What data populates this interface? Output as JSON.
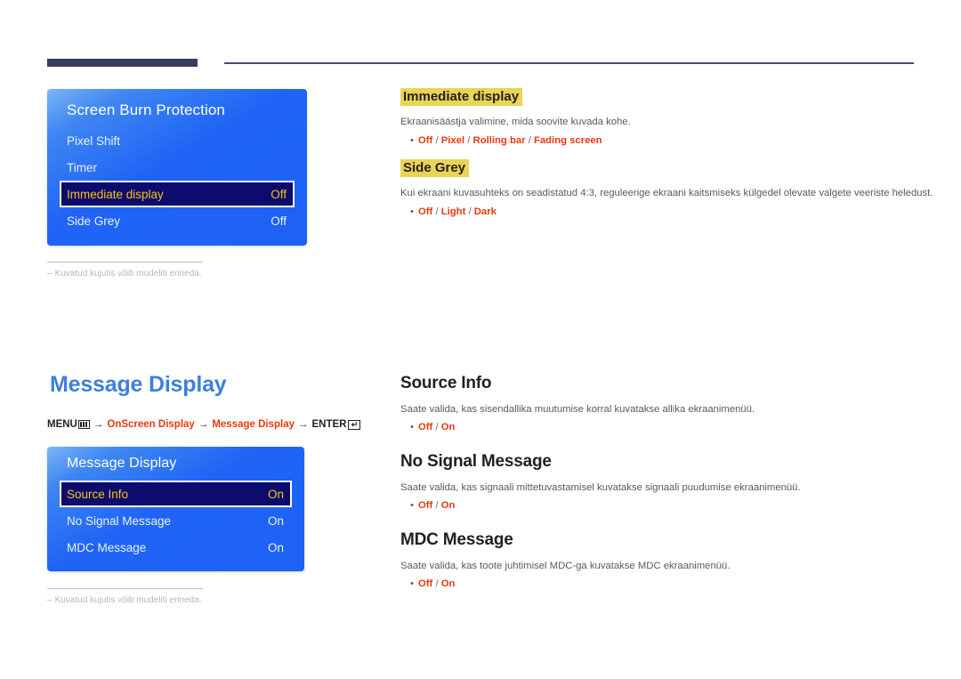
{
  "header": {
    "rule_label": "top-divider"
  },
  "osd_panels": [
    {
      "title": "Screen Burn Protection",
      "rows": [
        {
          "label": "Pixel Shift",
          "value": "",
          "selected": false
        },
        {
          "label": "Timer",
          "value": "",
          "selected": false
        },
        {
          "label": "Immediate display",
          "value": "Off",
          "selected": true
        },
        {
          "label": "Side Grey",
          "value": "Off",
          "selected": false
        }
      ]
    },
    {
      "title": "Message Display",
      "rows": [
        {
          "label": "Source Info",
          "value": "On",
          "selected": true
        },
        {
          "label": "No Signal Message",
          "value": "On",
          "selected": false
        },
        {
          "label": "MDC Message",
          "value": "On",
          "selected": false
        }
      ]
    }
  ],
  "footnotes": [
    {
      "dash": "‒",
      "text": "Kuvatud kujutis võib mudeliti erineda."
    },
    {
      "dash": "‒",
      "text": "Kuvatud kujutis võib mudeliti erineda."
    }
  ],
  "section": {
    "title": "Message Display",
    "breadcrumb": {
      "menu_label": "MENU",
      "menu_icon": "menu-bars-icon",
      "arrow": "→",
      "crumb1": "OnScreen Display",
      "crumb2": "Message Display",
      "enter_label": "ENTER",
      "enter_icon": "enter-return-icon",
      "enter_glyph": "↵"
    }
  },
  "content_blocks": [
    {
      "id": "immediate-display",
      "heading": "Immediate display",
      "heading_style": "highlight",
      "description": "Ekraanisäästja valimine, mida soovite kuvada kohe.",
      "bullet_dot": "•",
      "options": [
        {
          "text": "Off",
          "accent": true
        },
        {
          "text": "/",
          "accent": false
        },
        {
          "text": "Pixel",
          "accent": true
        },
        {
          "text": "/",
          "accent": false
        },
        {
          "text": "Rolling bar",
          "accent": true
        },
        {
          "text": "/",
          "accent": false
        },
        {
          "text": "Fading screen",
          "accent": true
        }
      ]
    },
    {
      "id": "side-grey",
      "heading": "Side Grey",
      "heading_style": "highlight",
      "description": "Kui ekraani kuvasuhteks on seadistatud 4:3, reguleerige ekraani kaitsmiseks külgedel olevate valgete veeriste heledust.",
      "bullet_dot": "•",
      "options": [
        {
          "text": "Off",
          "accent": true
        },
        {
          "text": "/",
          "accent": false
        },
        {
          "text": "Light",
          "accent": true
        },
        {
          "text": "/",
          "accent": false
        },
        {
          "text": "Dark",
          "accent": true
        }
      ]
    },
    {
      "id": "source-info",
      "heading": "Source Info",
      "heading_style": "big",
      "description": "Saate valida, kas sisendallika muutumise korral kuvatakse allika ekraanimenüü.",
      "bullet_dot": "•",
      "options": [
        {
          "text": "Off",
          "accent": true
        },
        {
          "text": "/",
          "accent": false
        },
        {
          "text": "On",
          "accent": true
        }
      ]
    },
    {
      "id": "no-signal-message",
      "heading": "No Signal Message",
      "heading_style": "big",
      "description": "Saate valida, kas signaali mittetuvastamisel kuvatakse signaali puudumise ekraanimenüü.",
      "bullet_dot": "•",
      "options": [
        {
          "text": "Off",
          "accent": true
        },
        {
          "text": "/",
          "accent": false
        },
        {
          "text": "On",
          "accent": true
        }
      ]
    },
    {
      "id": "mdc-message",
      "heading": "MDC Message",
      "heading_style": "big",
      "description": "Saate valida, kas toote juhtimisel MDC-ga kuvatakse MDC ekraanimenüü.",
      "bullet_dot": "•",
      "options": [
        {
          "text": "Off",
          "accent": true
        },
        {
          "text": "/",
          "accent": false
        },
        {
          "text": "On",
          "accent": true
        }
      ]
    }
  ],
  "colors": {
    "accent_red": "#e8380d",
    "heading_blue": "#3d7fe0",
    "highlight_yellow": "#e9d456",
    "osd_blue": "#1f64f5",
    "osd_selected_navy": "#0d0b6e",
    "osd_selected_text": "#f5c518",
    "rule_navy": "#373c5e"
  }
}
